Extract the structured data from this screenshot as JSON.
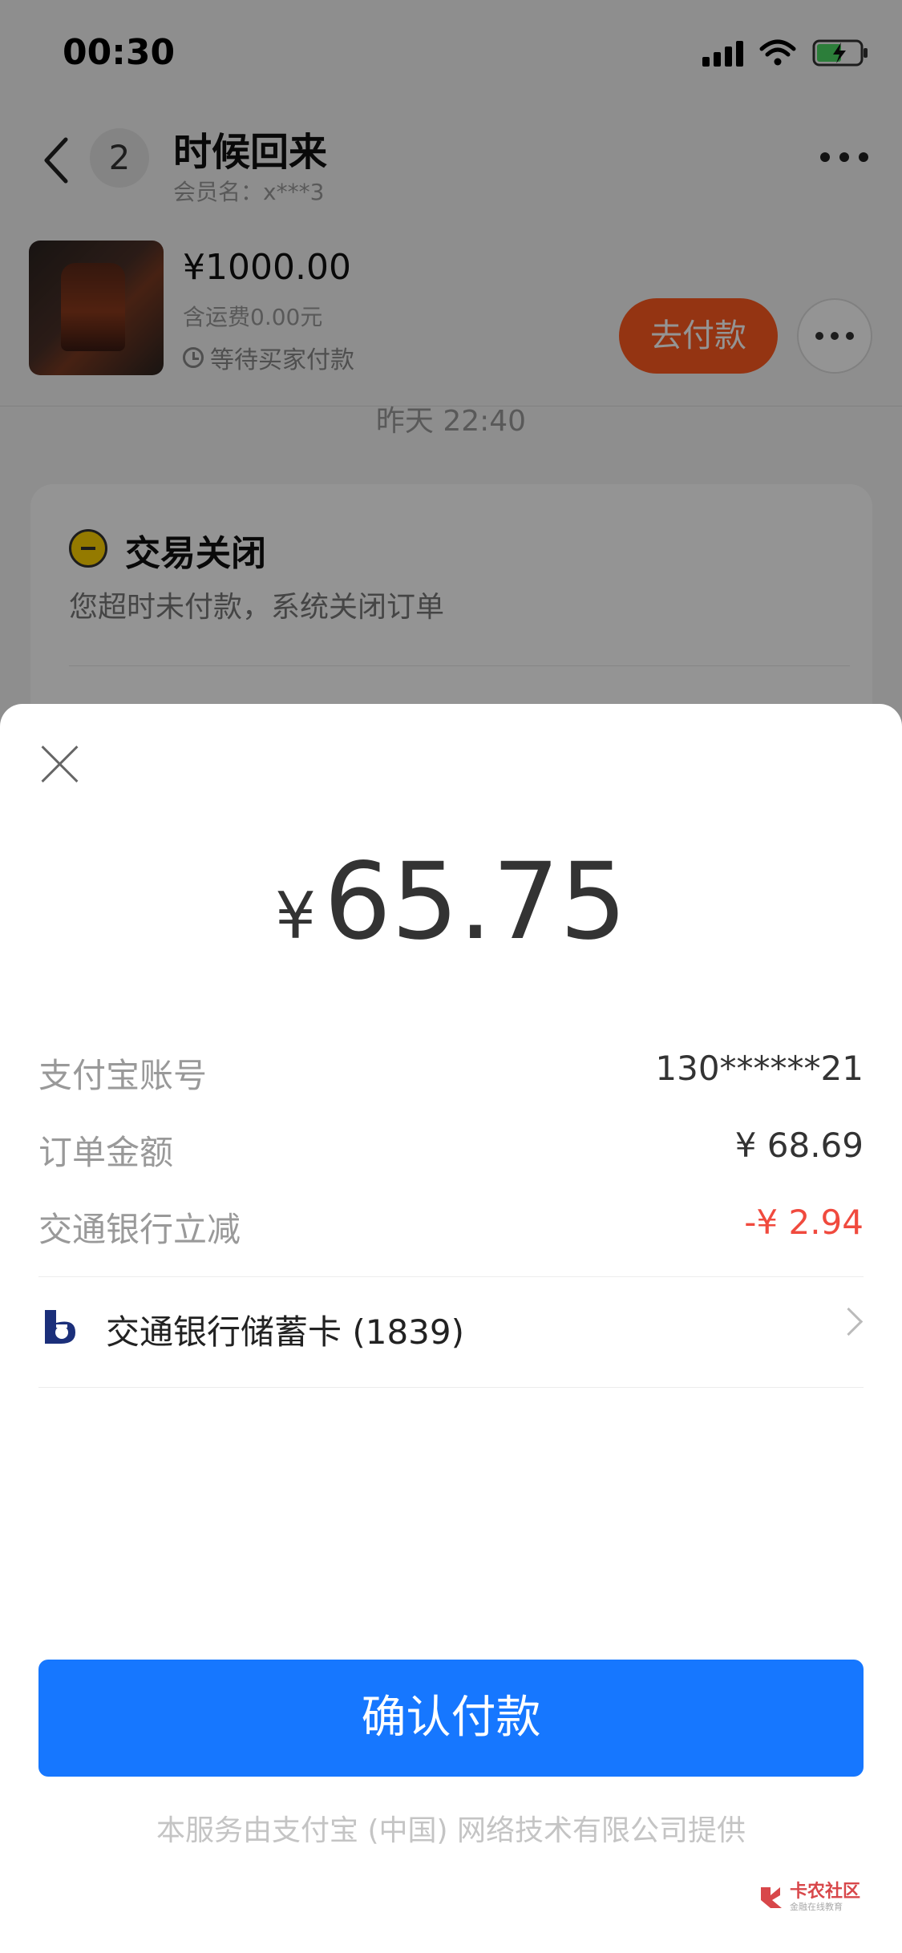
{
  "status_bar": {
    "time": "00:30"
  },
  "chat": {
    "unread_count": "2",
    "name": "时候回来",
    "member": "会员名：x***3"
  },
  "product": {
    "price": "¥1000.00",
    "shipping": "含运费0.00元",
    "status": "等待买家付款",
    "pay_label": "去付款"
  },
  "message": {
    "time": "昨天 22:40",
    "card_title": "交易关闭",
    "card_desc": "您超时未付款，系统关闭订单"
  },
  "payment_sheet": {
    "currency": "¥",
    "amount": "65.75",
    "rows": [
      {
        "label": "支付宝账号",
        "value": "130******21"
      },
      {
        "label": "订单金额",
        "value": "¥ 68.69"
      },
      {
        "label": "交通银行立减",
        "value": "-¥ 2.94"
      }
    ],
    "bank": "交通银行储蓄卡 (1839)",
    "confirm_label": "确认付款",
    "footer": "本服务由支付宝 (中国) 网络技术有限公司提供"
  },
  "watermark": {
    "title": "卡农社区",
    "subtitle": "金融在线教育"
  },
  "colors": {
    "primary": "#1677ff",
    "discount": "#f04a3e",
    "pay_button": "#ff5a1f"
  }
}
